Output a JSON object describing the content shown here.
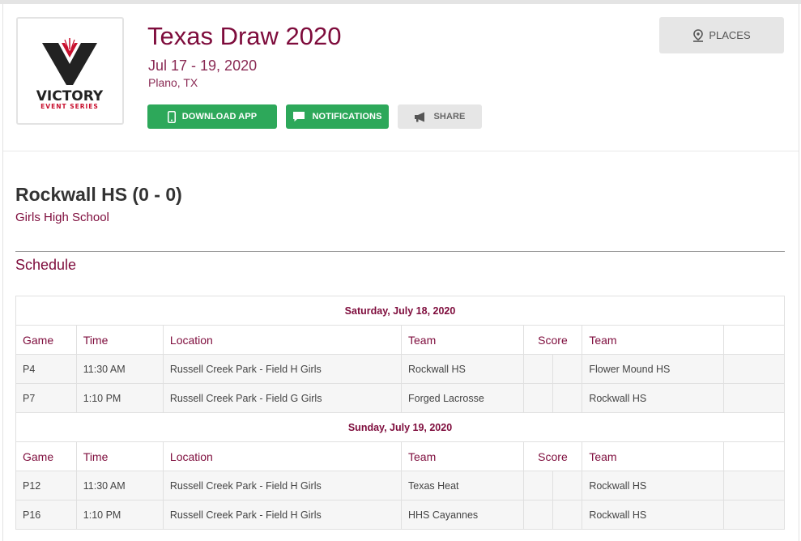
{
  "event": {
    "title": "Texas Draw 2020",
    "dates": "Jul 17 - 19, 2020",
    "city": "Plano, TX",
    "logo_text": "VICTORY",
    "logo_subtext": "EVENT SERIES"
  },
  "actions": {
    "download_app": "DOWNLOAD APP",
    "notifications": "NOTIFICATIONS",
    "share": "SHARE",
    "places": "PLACES"
  },
  "team": {
    "name": "Rockwall HS (0 - 0)",
    "division": "Girls High School"
  },
  "schedule": {
    "title": "Schedule",
    "columns": {
      "game": "Game",
      "time": "Time",
      "location": "Location",
      "team": "Team",
      "score": "Score",
      "team2": "Team"
    },
    "days": [
      {
        "date": "Saturday, July 18, 2020",
        "games": [
          {
            "game": "P4",
            "time": "11:30 AM",
            "location": "Russell Creek Park - Field H Girls",
            "team1": "Rockwall HS",
            "team2": "Flower Mound HS"
          },
          {
            "game": "P7",
            "time": "1:10 PM",
            "location": "Russell Creek Park - Field G Girls",
            "team1": "Forged Lacrosse",
            "team2": "Rockwall HS"
          }
        ]
      },
      {
        "date": "Sunday, July 19, 2020",
        "games": [
          {
            "game": "P12",
            "time": "11:30 AM",
            "location": "Russell Creek Park - Field H Girls",
            "team1": "Texas Heat",
            "team2": "Rockwall HS"
          },
          {
            "game": "P16",
            "time": "1:10 PM",
            "location": "Russell Creek Park - Field H Girls",
            "team1": "HHS Cayannes",
            "team2": "Rockwall HS"
          }
        ]
      }
    ]
  },
  "colors": {
    "brand": "#7e0c3c",
    "green": "#2da85a",
    "gray_button": "#e6e6e6"
  }
}
